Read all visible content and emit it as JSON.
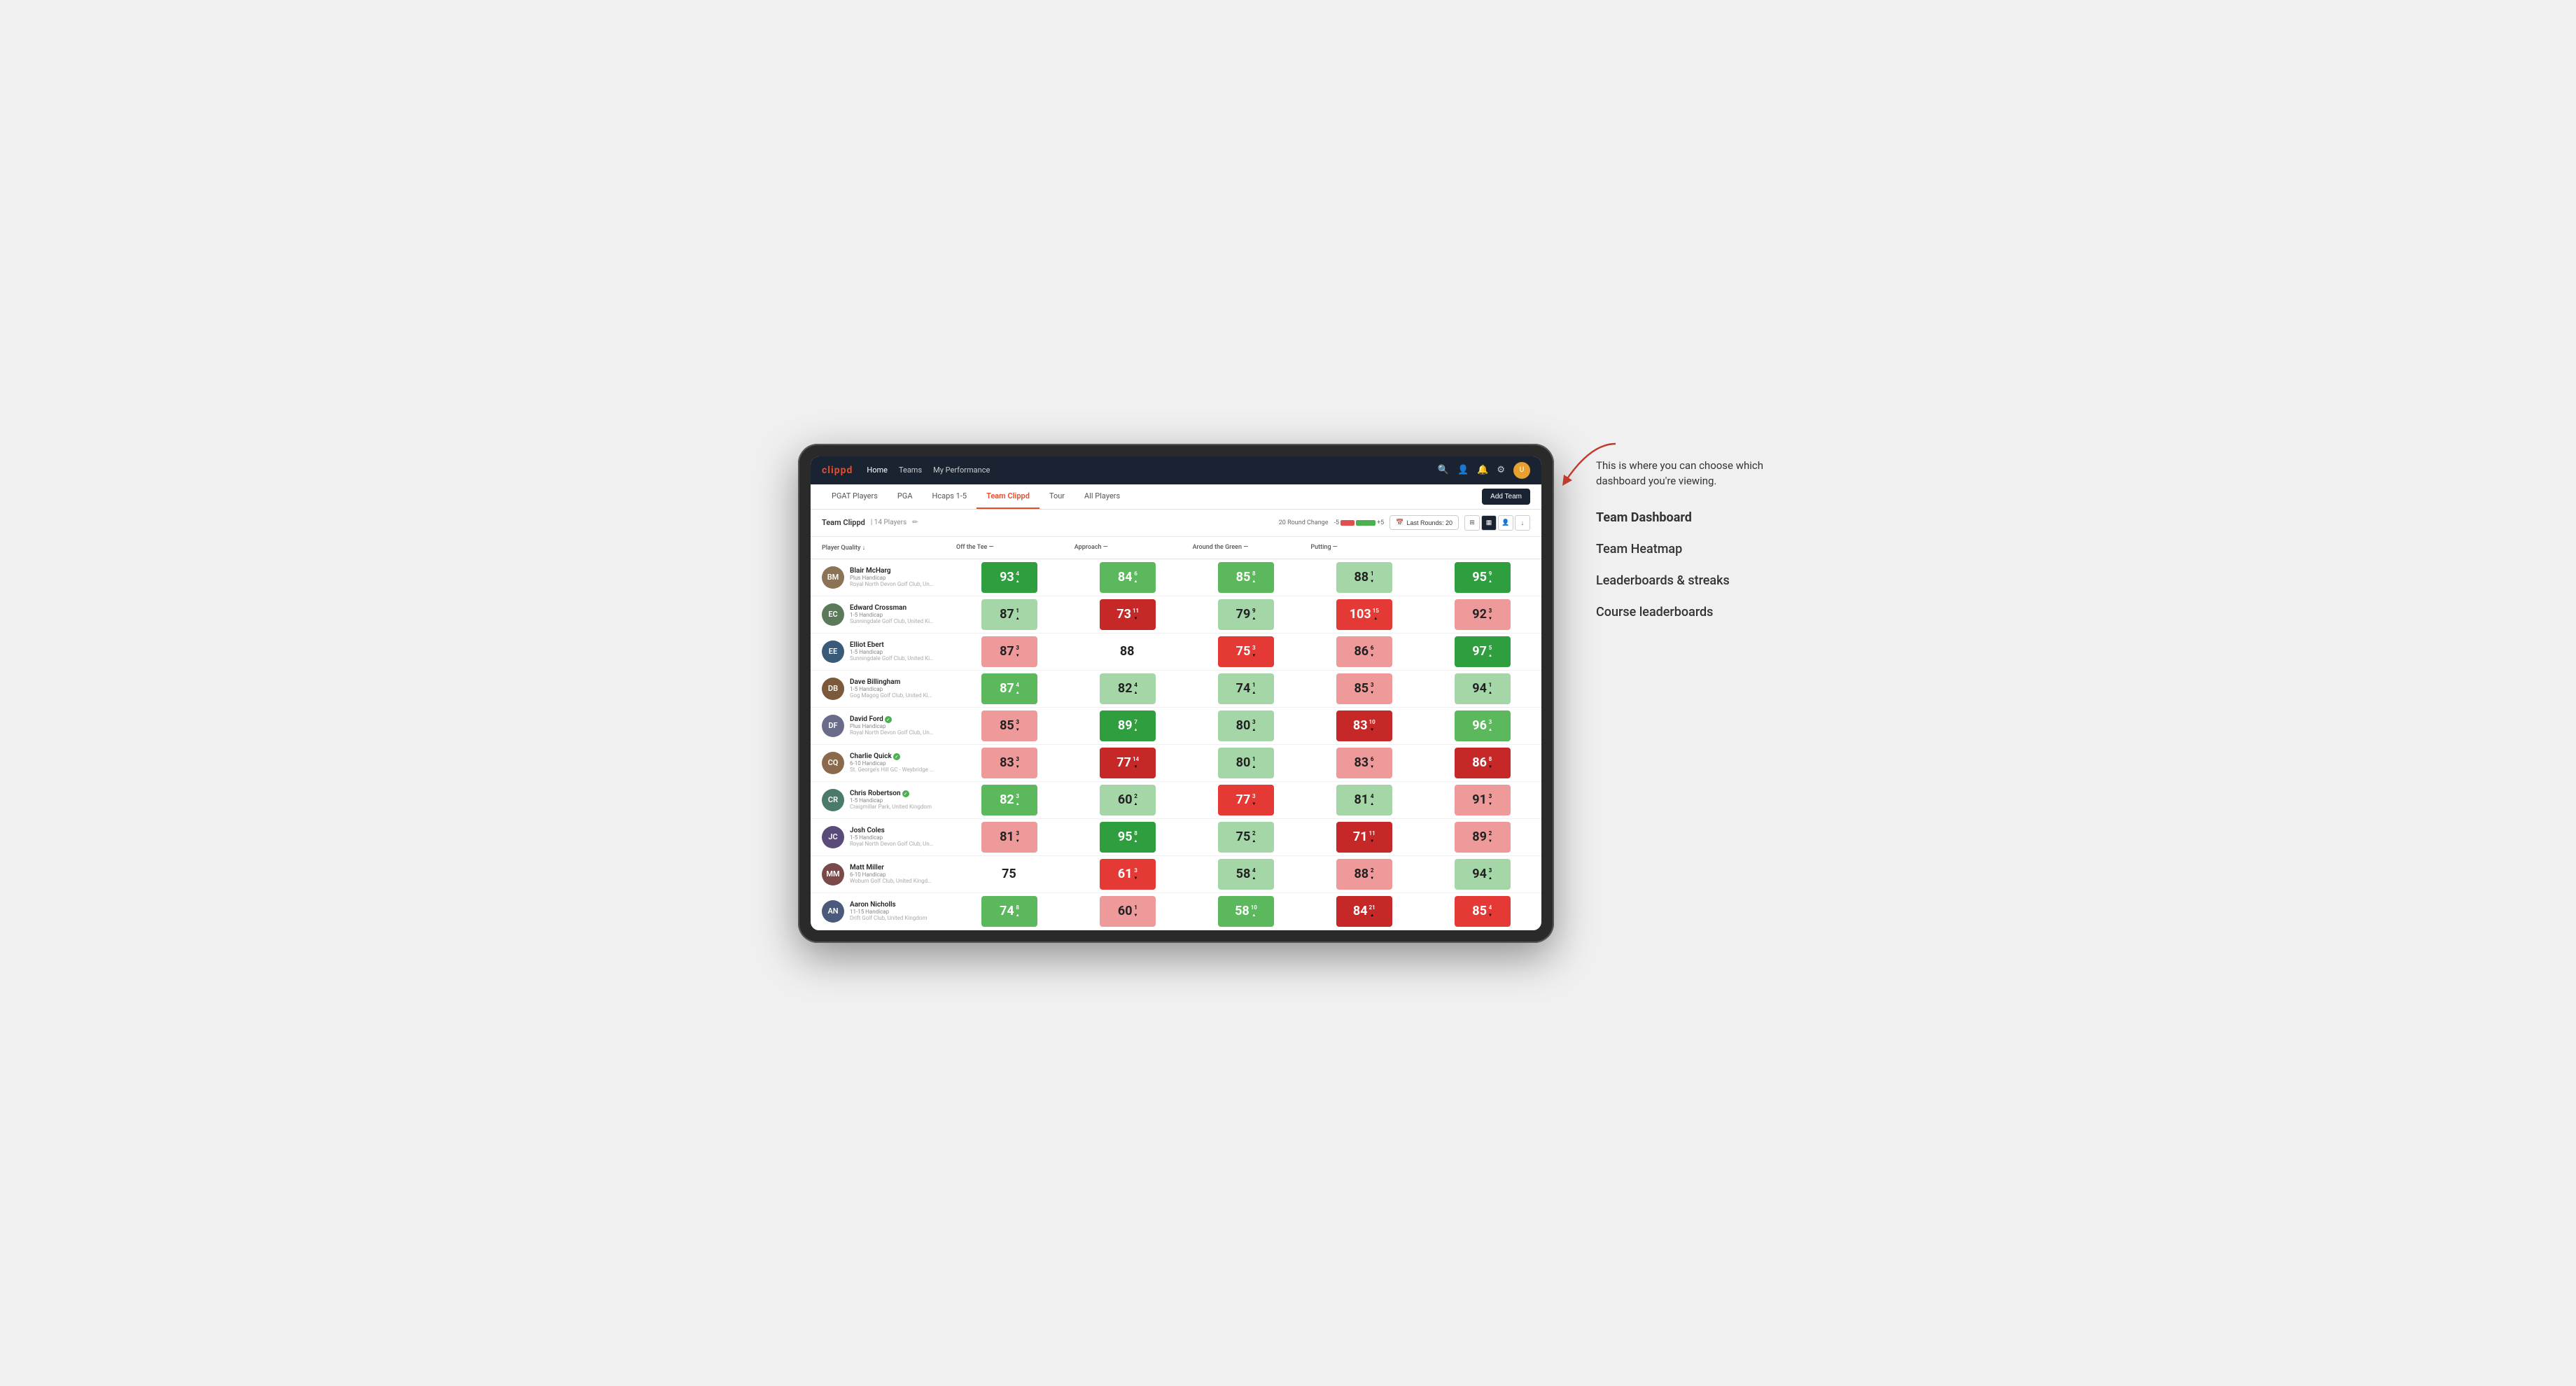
{
  "app": {
    "logo": "clippd",
    "nav_links": [
      "Home",
      "Teams",
      "My Performance"
    ],
    "sub_tabs": [
      "PGAT Players",
      "PGA",
      "Hcaps 1-5",
      "Team Clippd",
      "Tour",
      "All Players"
    ],
    "active_tab": "Team Clippd",
    "add_team_label": "Add Team",
    "team_name": "Team Clippd",
    "team_count": "14 Players",
    "round_change_label": "20 Round Change",
    "bar_minus": "-5",
    "bar_plus": "+5",
    "last_rounds_label": "Last Rounds: 20"
  },
  "columns": {
    "player": "Player Quality ↓",
    "off_tee": "Off the Tee —",
    "approach": "Approach —",
    "around_green": "Around the Green —",
    "putting": "Putting —"
  },
  "players": [
    {
      "name": "Blair McHarg",
      "handicap": "Plus Handicap",
      "club": "Royal North Devon Golf Club, United Kingdom",
      "avatar_color": "#8B7355",
      "initials": "BM",
      "pq": {
        "value": 93,
        "change": 4,
        "dir": "up",
        "bg": "bg-green-dark"
      },
      "ott": {
        "value": 84,
        "change": 6,
        "dir": "up",
        "bg": "bg-green-mid"
      },
      "app": {
        "value": 85,
        "change": 8,
        "dir": "up",
        "bg": "bg-green-mid"
      },
      "atg": {
        "value": 88,
        "change": 1,
        "dir": "down",
        "bg": "bg-green-light"
      },
      "putt": {
        "value": 95,
        "change": 9,
        "dir": "up",
        "bg": "bg-green-dark"
      }
    },
    {
      "name": "Edward Crossman",
      "handicap": "1-5 Handicap",
      "club": "Sunningdale Golf Club, United Kingdom",
      "avatar_color": "#5a7a5a",
      "initials": "EC",
      "pq": {
        "value": 87,
        "change": 1,
        "dir": "up",
        "bg": "bg-green-light"
      },
      "ott": {
        "value": 73,
        "change": 11,
        "dir": "down",
        "bg": "bg-red-dark"
      },
      "app": {
        "value": 79,
        "change": 9,
        "dir": "up",
        "bg": "bg-green-light"
      },
      "atg": {
        "value": 103,
        "change": 15,
        "dir": "up",
        "bg": "bg-red-mid"
      },
      "putt": {
        "value": 92,
        "change": 3,
        "dir": "down",
        "bg": "bg-red-light"
      }
    },
    {
      "name": "Elliot Ebert",
      "handicap": "1-5 Handicap",
      "club": "Sunningdale Golf Club, United Kingdom",
      "avatar_color": "#3a5a7a",
      "initials": "EE",
      "pq": {
        "value": 87,
        "change": 3,
        "dir": "down",
        "bg": "bg-red-light"
      },
      "ott": {
        "value": 88,
        "change": 0,
        "dir": "none",
        "bg": "bg-white"
      },
      "app": {
        "value": 75,
        "change": 3,
        "dir": "down",
        "bg": "bg-red-mid"
      },
      "atg": {
        "value": 86,
        "change": 6,
        "dir": "down",
        "bg": "bg-red-light"
      },
      "putt": {
        "value": 97,
        "change": 5,
        "dir": "up",
        "bg": "bg-green-dark"
      }
    },
    {
      "name": "Dave Billingham",
      "handicap": "1-5 Handicap",
      "club": "Gog Magog Golf Club, United Kingdom",
      "avatar_color": "#7a5a3a",
      "initials": "DB",
      "pq": {
        "value": 87,
        "change": 4,
        "dir": "up",
        "bg": "bg-green-mid"
      },
      "ott": {
        "value": 82,
        "change": 4,
        "dir": "up",
        "bg": "bg-green-light"
      },
      "app": {
        "value": 74,
        "change": 1,
        "dir": "up",
        "bg": "bg-green-light"
      },
      "atg": {
        "value": 85,
        "change": 3,
        "dir": "down",
        "bg": "bg-red-light"
      },
      "putt": {
        "value": 94,
        "change": 1,
        "dir": "up",
        "bg": "bg-green-light"
      }
    },
    {
      "name": "David Ford",
      "handicap": "Plus Handicap",
      "club": "Royal North Devon Golf Club, United Kingdom",
      "avatar_color": "#6a6a8a",
      "initials": "DF",
      "verified": true,
      "pq": {
        "value": 85,
        "change": 3,
        "dir": "down",
        "bg": "bg-red-light"
      },
      "ott": {
        "value": 89,
        "change": 7,
        "dir": "up",
        "bg": "bg-green-dark"
      },
      "app": {
        "value": 80,
        "change": 3,
        "dir": "up",
        "bg": "bg-green-light"
      },
      "atg": {
        "value": 83,
        "change": 10,
        "dir": "down",
        "bg": "bg-red-dark"
      },
      "putt": {
        "value": 96,
        "change": 3,
        "dir": "up",
        "bg": "bg-green-mid"
      }
    },
    {
      "name": "Charlie Quick",
      "handicap": "6-10 Handicap",
      "club": "St. George's Hill GC - Weybridge - Surrey, Uni...",
      "avatar_color": "#8a6a4a",
      "initials": "CQ",
      "verified": true,
      "pq": {
        "value": 83,
        "change": 3,
        "dir": "down",
        "bg": "bg-red-light"
      },
      "ott": {
        "value": 77,
        "change": 14,
        "dir": "down",
        "bg": "bg-red-dark"
      },
      "app": {
        "value": 80,
        "change": 1,
        "dir": "up",
        "bg": "bg-green-light"
      },
      "atg": {
        "value": 83,
        "change": 6,
        "dir": "down",
        "bg": "bg-red-light"
      },
      "putt": {
        "value": 86,
        "change": 8,
        "dir": "down",
        "bg": "bg-red-dark"
      }
    },
    {
      "name": "Chris Robertson",
      "handicap": "1-5 Handicap",
      "club": "Craigmillar Park, United Kingdom",
      "avatar_color": "#4a7a6a",
      "initials": "CR",
      "verified": true,
      "pq": {
        "value": 82,
        "change": 3,
        "dir": "up",
        "bg": "bg-green-mid"
      },
      "ott": {
        "value": 60,
        "change": 2,
        "dir": "up",
        "bg": "bg-green-light"
      },
      "app": {
        "value": 77,
        "change": 3,
        "dir": "down",
        "bg": "bg-red-mid"
      },
      "atg": {
        "value": 81,
        "change": 4,
        "dir": "up",
        "bg": "bg-green-light"
      },
      "putt": {
        "value": 91,
        "change": 3,
        "dir": "down",
        "bg": "bg-red-light"
      }
    },
    {
      "name": "Josh Coles",
      "handicap": "1-5 Handicap",
      "club": "Royal North Devon Golf Club, United Kingdom",
      "avatar_color": "#5a4a7a",
      "initials": "JC",
      "pq": {
        "value": 81,
        "change": 3,
        "dir": "down",
        "bg": "bg-red-light"
      },
      "ott": {
        "value": 95,
        "change": 8,
        "dir": "up",
        "bg": "bg-green-dark"
      },
      "app": {
        "value": 75,
        "change": 2,
        "dir": "up",
        "bg": "bg-green-light"
      },
      "atg": {
        "value": 71,
        "change": 11,
        "dir": "down",
        "bg": "bg-red-dark"
      },
      "putt": {
        "value": 89,
        "change": 2,
        "dir": "down",
        "bg": "bg-red-light"
      }
    },
    {
      "name": "Matt Miller",
      "handicap": "6-10 Handicap",
      "club": "Woburn Golf Club, United Kingdom",
      "avatar_color": "#7a4a4a",
      "initials": "MM",
      "pq": {
        "value": 75,
        "change": 0,
        "dir": "none",
        "bg": "bg-white"
      },
      "ott": {
        "value": 61,
        "change": 3,
        "dir": "down",
        "bg": "bg-red-mid"
      },
      "app": {
        "value": 58,
        "change": 4,
        "dir": "up",
        "bg": "bg-green-light"
      },
      "atg": {
        "value": 88,
        "change": 2,
        "dir": "down",
        "bg": "bg-red-light"
      },
      "putt": {
        "value": 94,
        "change": 3,
        "dir": "up",
        "bg": "bg-green-light"
      }
    },
    {
      "name": "Aaron Nicholls",
      "handicap": "11-15 Handicap",
      "club": "Drift Golf Club, United Kingdom",
      "avatar_color": "#4a5a7a",
      "initials": "AN",
      "pq": {
        "value": 74,
        "change": 8,
        "dir": "up",
        "bg": "bg-green-mid"
      },
      "ott": {
        "value": 60,
        "change": 1,
        "dir": "down",
        "bg": "bg-red-light"
      },
      "app": {
        "value": 58,
        "change": 10,
        "dir": "up",
        "bg": "bg-green-mid"
      },
      "atg": {
        "value": 84,
        "change": 21,
        "dir": "up",
        "bg": "bg-red-dark"
      },
      "putt": {
        "value": 85,
        "change": 4,
        "dir": "down",
        "bg": "bg-red-mid"
      }
    }
  ],
  "annotation": {
    "description": "This is where you can choose which dashboard you're viewing.",
    "menu_items": [
      {
        "label": "Team Dashboard",
        "active": true
      },
      {
        "label": "Team Heatmap",
        "active": false
      },
      {
        "label": "Leaderboards & streaks",
        "active": false
      },
      {
        "label": "Course leaderboards",
        "active": false
      }
    ]
  }
}
